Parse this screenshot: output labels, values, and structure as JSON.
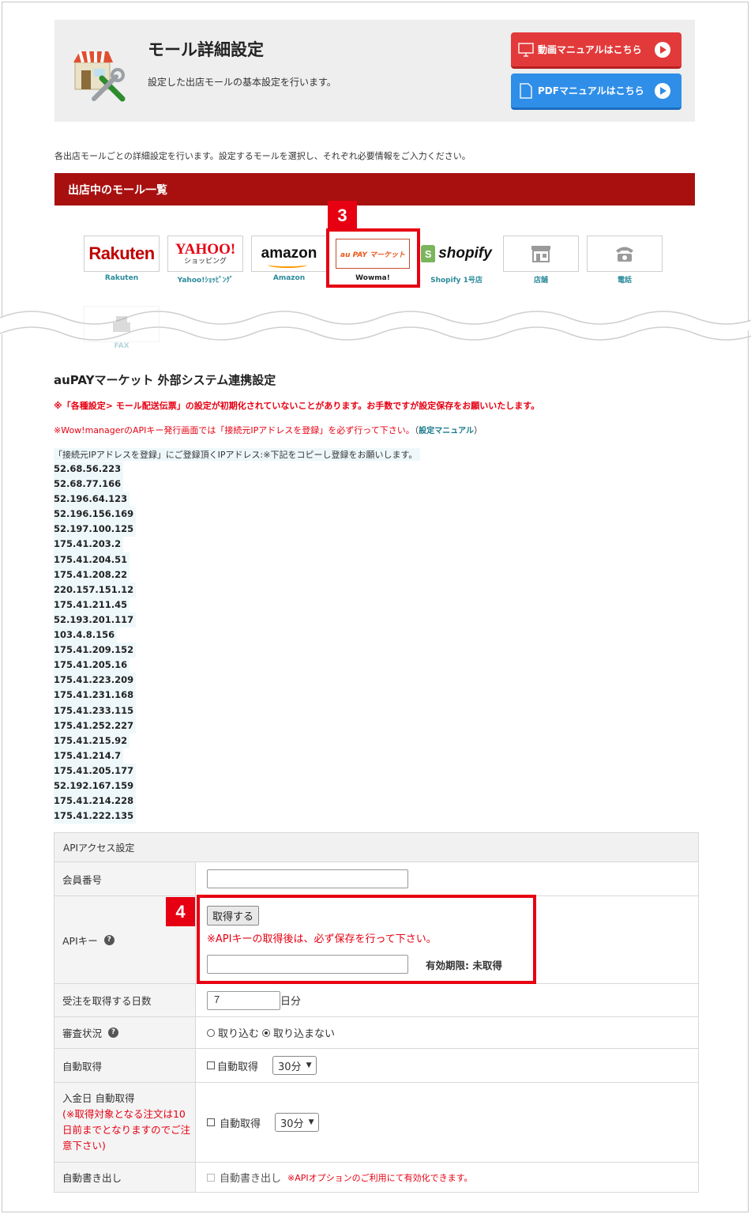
{
  "header": {
    "title": "モール詳細設定",
    "subtitle": "設定した出店モールの基本設定を行います。",
    "video_btn": "動画マニュアルはこちら",
    "pdf_btn": "PDFマニュアルはこちら"
  },
  "intro": "各出店モールごとの詳細設定を行います。設定するモールを選択し、それぞれ必要情報をご入力ください。",
  "mall_list_title": "出店中のモール一覧",
  "malls": [
    {
      "logo": "Rakuten",
      "label": "Rakuten"
    },
    {
      "logo_top": "YAHOO!",
      "logo_sub": "ショッピング",
      "label": "Yahoo!ｼｮｯﾋﾟﾝｸﾞ"
    },
    {
      "logo": "amazon",
      "label": "Amazon"
    },
    {
      "logo": "au PAY マーケット",
      "label": "Wowma!"
    },
    {
      "logo": "shopify",
      "label": "Shopify 1号店"
    },
    {
      "icon": "store-icon",
      "label": "店舗"
    },
    {
      "icon": "phone-icon",
      "label": "電話"
    },
    {
      "icon": "fax-icon",
      "label": "FAX"
    }
  ],
  "badges": {
    "step3": "3",
    "step4": "4"
  },
  "section_title": "auPAYマーケット 外部システム連携設定",
  "warning1": "※「各種設定> モール配送伝票」の設定が初期化されていないことがあります。お手数ですが設定保存をお願いいたします。",
  "warning2": "※Wow!managerのAPIキー発行画面では「接続元IPアドレスを登録」を必ず行って下さい。",
  "warning2_open": "（",
  "manual_link": "設定マニュアル",
  "warning2_close": "）",
  "ip_note": "「接続元IPアドレスを登録」にご登録頂くIPアドレス:※下記をコピーし登録をお願いします。",
  "ips": [
    "52.68.56.223",
    "52.68.77.166",
    "52.196.64.123",
    "52.196.156.169",
    "52.197.100.125",
    "175.41.203.2",
    "175.41.204.51",
    "175.41.208.22",
    "220.157.151.12",
    "175.41.211.45",
    "52.193.201.117",
    "103.4.8.156",
    "175.41.209.152",
    "175.41.205.16",
    "175.41.223.209",
    "175.41.231.168",
    "175.41.233.115",
    "175.41.252.227",
    "175.41.215.92",
    "175.41.214.7",
    "175.41.205.177",
    "52.192.167.159",
    "175.41.214.228",
    "175.41.222.135"
  ],
  "table": {
    "header": "APIアクセス設定",
    "member_label": "会員番号",
    "member_value": "",
    "apikey_label": "APIキー",
    "get_btn": "取得する",
    "apikey_note": "※APIキーの取得後は、必ず保存を行って下さい。",
    "apikey_value": "",
    "expiry": "有効期限: 未取得",
    "days_label": "受注を取得する日数",
    "days_value": "7",
    "days_unit": "日分",
    "review_label": "審査状況",
    "review_opt1": "取り込む",
    "review_opt2": "取り込まない",
    "auto_label": "自動取得",
    "auto_chk": "自動取得",
    "auto_select": "30分",
    "pay_label": "入金日 自動取得",
    "pay_note": "(※取得対象となる注文は10日前までとなりますのでご注意下さい)",
    "pay_chk": "自動取得",
    "pay_select": "30分",
    "export_label": "自動書き出し",
    "export_chk": "自動書き出し",
    "export_note": "※APIオプションのご利用にて有効化できます。"
  },
  "colors": {
    "accent_red": "#e60012",
    "bar_red": "#a81010",
    "link_teal": "#2a8a9a",
    "btn_red": "#e23a3a",
    "btn_blue": "#2f8ee8"
  }
}
